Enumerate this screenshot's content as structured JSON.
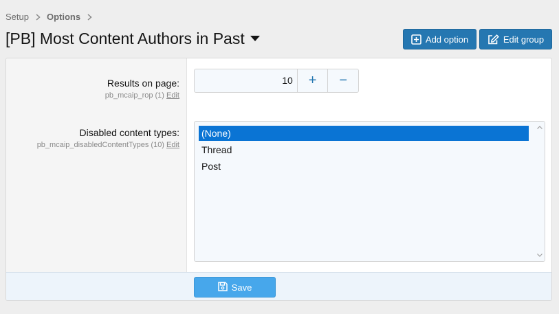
{
  "breadcrumb": {
    "items": [
      "Setup",
      "Options"
    ]
  },
  "page": {
    "title": "[PB] Most Content Authors in Past"
  },
  "buttons": {
    "add_option": "Add option",
    "edit_group": "Edit group",
    "save": "Save"
  },
  "options": {
    "results": {
      "label": "Results on page:",
      "key": "pb_mcaip_rop (1)",
      "edit": "Edit",
      "value": "10",
      "plus": "+",
      "minus": "−"
    },
    "disabled": {
      "label": "Disabled content types:",
      "key": "pb_mcaip_disabledContentTypes (10)",
      "edit": "Edit",
      "items": [
        "(None)",
        "Thread",
        "Post"
      ],
      "selected": "(None)"
    }
  },
  "colors": {
    "accent": "#2577b1",
    "save": "#47a7eb",
    "selected": "#0a74d4"
  }
}
